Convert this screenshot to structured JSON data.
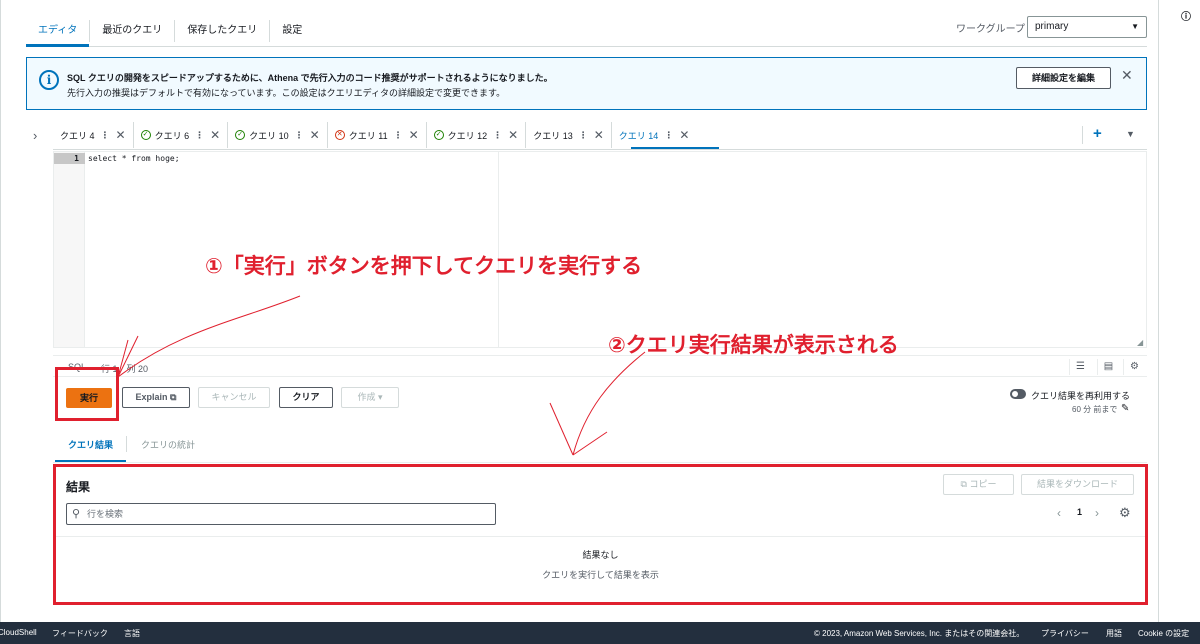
{
  "top_tabs": [
    {
      "label": "エディタ",
      "active": true
    },
    {
      "label": "最近のクエリ",
      "active": false
    },
    {
      "label": "保存したクエリ",
      "active": false
    },
    {
      "label": "設定",
      "active": false
    }
  ],
  "workgroup": {
    "label": "ワークグループ",
    "value": "primary"
  },
  "alert": {
    "title": "SQL クエリの開発をスピードアップするために、Athena で先行入力のコード推奨がサポートされるようになりました。",
    "body": "先行入力の推奨はデフォルトで有効になっています。この設定はクエリエディタの詳細設定で変更できます。",
    "button": "詳細設定を編集"
  },
  "query_tabs": [
    {
      "label": "クエリ 4",
      "status": ""
    },
    {
      "label": "クエリ 6",
      "status": "success"
    },
    {
      "label": "クエリ 10",
      "status": "success"
    },
    {
      "label": "クエリ 11",
      "status": "error"
    },
    {
      "label": "クエリ 12",
      "status": "success"
    },
    {
      "label": "クエリ 13",
      "status": ""
    },
    {
      "label": "クエリ 14",
      "status": "",
      "active": true
    }
  ],
  "editor": {
    "line_number": "1",
    "code": "select * from hoge;"
  },
  "status_bar": {
    "language": "SQL",
    "position": "行 1、列 20"
  },
  "toolbar": {
    "run": "実行",
    "explain": "Explain",
    "cancel": "キャンセル",
    "clear": "クリア",
    "create": "作成"
  },
  "reuse": {
    "label": "クエリ結果を再利用する",
    "sub": "60 分 前まで"
  },
  "result_tabs": [
    {
      "label": "クエリ結果",
      "active": true
    },
    {
      "label": "クエリの統計",
      "active": false
    }
  ],
  "results": {
    "title": "結果",
    "copy": "コピー",
    "download": "結果をダウンロード",
    "search_placeholder": "行を検索",
    "page": "1",
    "empty_title": "結果なし",
    "empty_sub": "クエリを実行して結果を表示"
  },
  "annotations": {
    "step1": "①「実行」ボタンを押下してクエリを実行する",
    "step2": "②クエリ実行結果が表示される",
    "color": "#e0202e"
  },
  "footer": {
    "cloudshell": "CloudShell",
    "feedback": "フィードバック",
    "language": "言語",
    "copyright": "© 2023, Amazon Web Services, Inc. またはその関連会社。",
    "privacy": "プライバシー",
    "terms": "用語",
    "cookie": "Cookie の設定"
  },
  "colors": {
    "accent": "#0073bb",
    "run_button": "#ec7211",
    "footer": "#232f3e"
  }
}
